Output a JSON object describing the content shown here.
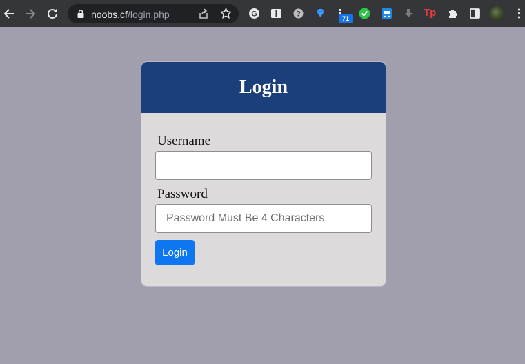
{
  "browser": {
    "url_host": "noobs.cf",
    "url_path": "/login.php",
    "extension_badge": "71",
    "extension_text_icon": "Tp",
    "icons": {
      "back": "back-arrow-icon",
      "forward": "forward-arrow-icon",
      "reload": "reload-icon",
      "lock": "lock-icon",
      "share": "share-icon",
      "bookmark": "star-icon",
      "extensions": [
        "grammarly-icon",
        "reader-icon",
        "help-circle-icon",
        "gem-icon",
        "extension-counter-icon",
        "checkmark-icon",
        "cart-icon",
        "download-icon",
        "tp-icon",
        "puzzle-icon",
        "side-panel-icon",
        "profile-avatar",
        "kebab-menu-icon"
      ]
    }
  },
  "login": {
    "title": "Login",
    "username_label": "Username",
    "username_value": "",
    "password_label": "Password",
    "password_placeholder": "Password Must Be 4 Characters",
    "submit_label": "Login"
  },
  "colors": {
    "page_bg": "#a19fae",
    "header_bg": "#1b3f7b",
    "card_bg": "#dcdadb",
    "button_bg": "#0d76f0",
    "toolbar_bg": "#35363a"
  }
}
